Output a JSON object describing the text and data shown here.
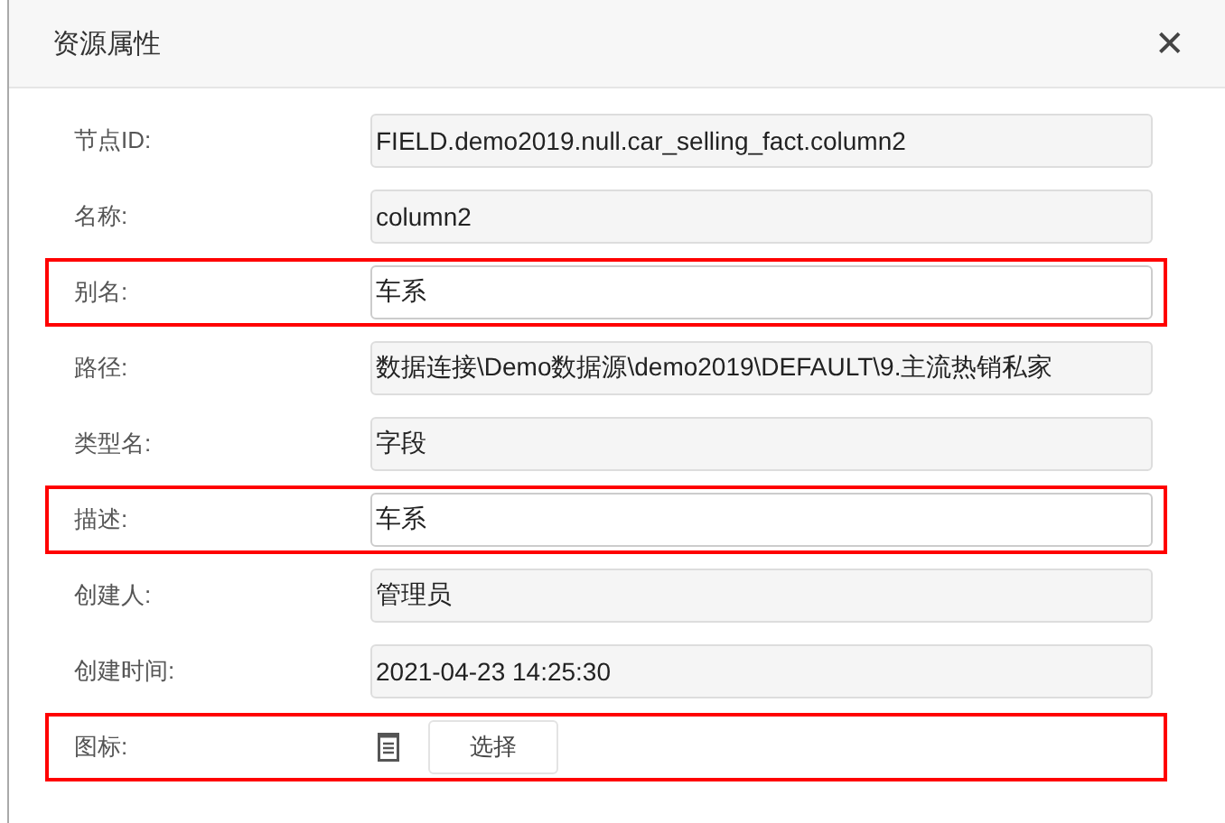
{
  "dialog": {
    "title": "资源属性",
    "close": "✕"
  },
  "rows": [
    {
      "kind": "field",
      "label": "节点ID:",
      "value": "FIELD.demo2019.null.car_selling_fact.column2",
      "editable": false,
      "highlighted": false
    },
    {
      "kind": "field",
      "label": "名称:",
      "value": "column2",
      "editable": false,
      "highlighted": false
    },
    {
      "kind": "field",
      "label": "别名:",
      "value": "车系",
      "editable": true,
      "highlighted": true
    },
    {
      "kind": "field",
      "label": "路径:",
      "value": "数据连接\\Demo数据源\\demo2019\\DEFAULT\\9.主流热销私家",
      "editable": false,
      "highlighted": false
    },
    {
      "kind": "field",
      "label": "类型名:",
      "value": "字段",
      "editable": false,
      "highlighted": false
    },
    {
      "kind": "field",
      "label": "描述:",
      "value": "车系",
      "editable": true,
      "highlighted": true
    },
    {
      "kind": "field",
      "label": "创建人:",
      "value": "管理员",
      "editable": false,
      "highlighted": false
    },
    {
      "kind": "field",
      "label": "创建时间:",
      "value": "2021-04-23 14:25:30",
      "editable": false,
      "highlighted": false
    },
    {
      "kind": "icon",
      "label": "图标:",
      "button": "选择",
      "highlighted": true
    }
  ]
}
